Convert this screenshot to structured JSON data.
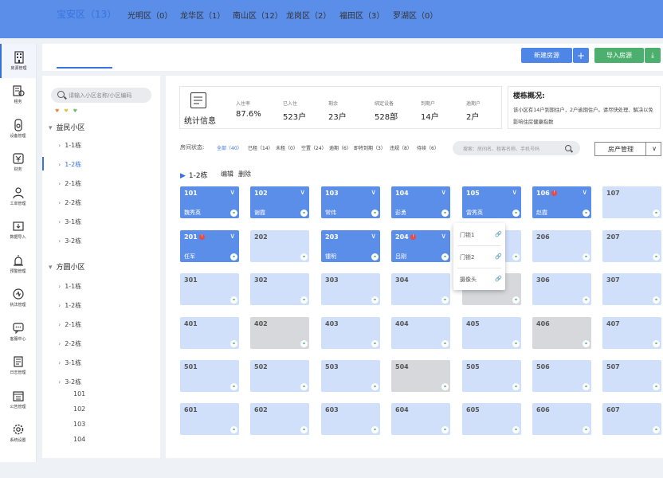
{
  "nav": [
    {
      "label": "房源管理",
      "icon": "building-icon",
      "active": true
    },
    {
      "label": "租务",
      "icon": "lease-icon"
    },
    {
      "label": "设备管理",
      "icon": "device-icon"
    },
    {
      "label": "财务",
      "icon": "finance-icon"
    },
    {
      "label": "工单管理",
      "icon": "worker-icon"
    },
    {
      "label": "数据导入",
      "icon": "import-icon"
    },
    {
      "label": "预警管理",
      "icon": "alarm-icon"
    },
    {
      "label": "执法管理",
      "icon": "law-icon"
    },
    {
      "label": "客服中心",
      "icon": "chat-icon"
    },
    {
      "label": "日志管理",
      "icon": "log-icon"
    },
    {
      "label": "公告管理",
      "icon": "notice-icon"
    },
    {
      "label": "系统设置",
      "icon": "gear-icon"
    }
  ],
  "districts": [
    "宝安区（13）",
    "光明区（0）",
    "龙华区（1）",
    "南山区（12）",
    "龙岗区（2）",
    "福田区（3）",
    "罗湖区（0）"
  ],
  "toolbar": {
    "new_label": "新建房源",
    "plus_label": "+",
    "import_label": "导入房源",
    "download_label": "⤓"
  },
  "tree": {
    "search_placeholder": "请输入小区名称/小区编码",
    "dots": "♥ ♥ ♥",
    "groups": [
      {
        "name": "益民小区",
        "items": [
          "1-1栋",
          "1-2栋",
          "2-1栋",
          "2-2栋",
          "3-1栋",
          "3-2栋"
        ]
      },
      {
        "name": "方圆小区",
        "items": [
          "1-1栋",
          "1-2栋",
          "2-1栋",
          "2-2栋",
          "3-1栋",
          "3-2栋"
        ],
        "subitems": [
          "101",
          "102",
          "103",
          "104"
        ]
      }
    ]
  },
  "stats": {
    "title": "统计信息",
    "items": [
      {
        "label": "入住率",
        "value": "87.6%"
      },
      {
        "label": "已入住",
        "value": "523户"
      },
      {
        "label": "剩余",
        "value": "23户"
      },
      {
        "label": "绑定设备",
        "value": "528部"
      },
      {
        "label": "到期户",
        "value": "14户"
      },
      {
        "label": "逾期户",
        "value": "2户"
      }
    ]
  },
  "overview": {
    "title": "楼栋概况:",
    "text": "该小区有14户到期住户，2户逾期住户。请尽快处理、解决以免影响住房健康指数"
  },
  "status": {
    "label": "房间状态:",
    "filters": [
      "全部（40）",
      "已租（14）",
      "未租（0）",
      "空置（24）",
      "逾期（6）",
      "即将到期（3）",
      "违规（8）",
      "待续（6）"
    ]
  },
  "room_search_placeholder": "搜索：房间名、租客名称、手机号码",
  "manage_label": "房产管理",
  "building": {
    "title": "1-2栋",
    "edit_label": "编辑",
    "delete_label": "删除"
  },
  "rooms": [
    [
      {
        "num": "101",
        "tenant": "魏秀英",
        "state": "occupied"
      },
      {
        "num": "102",
        "tenant": "谢霞",
        "state": "occupied"
      },
      {
        "num": "103",
        "tenant": "常伟",
        "state": "occupied"
      },
      {
        "num": "104",
        "tenant": "彭勇",
        "state": "occupied"
      },
      {
        "num": "105",
        "tenant": "雷秀英",
        "state": "occupied"
      },
      {
        "num": "106",
        "tenant": "赵霞",
        "state": "occupied",
        "warn": true
      },
      {
        "num": "107",
        "tenant": "",
        "state": "vacant"
      }
    ],
    [
      {
        "num": "201",
        "tenant": "任军",
        "state": "occupied",
        "warn": true
      },
      {
        "num": "202",
        "tenant": "",
        "state": "vacant"
      },
      {
        "num": "203",
        "tenant": "锺明",
        "state": "occupied"
      },
      {
        "num": "204",
        "tenant": "吕刚",
        "state": "occupied",
        "warn": true
      },
      {
        "num": "205",
        "tenant": "",
        "state": "vacant"
      },
      {
        "num": "206",
        "tenant": "",
        "state": "vacant"
      },
      {
        "num": "207",
        "tenant": "",
        "state": "vacant"
      }
    ],
    [
      {
        "num": "301",
        "tenant": "",
        "state": "vacant"
      },
      {
        "num": "302",
        "tenant": "",
        "state": "vacant"
      },
      {
        "num": "303",
        "tenant": "",
        "state": "vacant"
      },
      {
        "num": "304",
        "tenant": "",
        "state": "vacant"
      },
      {
        "num": "305",
        "tenant": "",
        "state": "grey"
      },
      {
        "num": "306",
        "tenant": "",
        "state": "vacant"
      },
      {
        "num": "307",
        "tenant": "",
        "state": "vacant"
      }
    ],
    [
      {
        "num": "401",
        "tenant": "",
        "state": "vacant"
      },
      {
        "num": "402",
        "tenant": "",
        "state": "grey"
      },
      {
        "num": "403",
        "tenant": "",
        "state": "vacant"
      },
      {
        "num": "404",
        "tenant": "",
        "state": "vacant"
      },
      {
        "num": "405",
        "tenant": "",
        "state": "vacant"
      },
      {
        "num": "406",
        "tenant": "",
        "state": "grey"
      },
      {
        "num": "407",
        "tenant": "",
        "state": "vacant"
      }
    ],
    [
      {
        "num": "501",
        "tenant": "",
        "state": "vacant"
      },
      {
        "num": "502",
        "tenant": "",
        "state": "vacant"
      },
      {
        "num": "503",
        "tenant": "",
        "state": "vacant"
      },
      {
        "num": "504",
        "tenant": "",
        "state": "grey"
      },
      {
        "num": "505",
        "tenant": "",
        "state": "vacant"
      },
      {
        "num": "506",
        "tenant": "",
        "state": "vacant"
      },
      {
        "num": "507",
        "tenant": "",
        "state": "vacant"
      }
    ],
    [
      {
        "num": "601",
        "tenant": "",
        "state": "vacant"
      },
      {
        "num": "602",
        "tenant": "",
        "state": "vacant"
      },
      {
        "num": "603",
        "tenant": "",
        "state": "vacant"
      },
      {
        "num": "604",
        "tenant": "",
        "state": "vacant"
      },
      {
        "num": "605",
        "tenant": "",
        "state": "vacant"
      },
      {
        "num": "606",
        "tenant": "",
        "state": "vacant"
      },
      {
        "num": "607",
        "tenant": "",
        "state": "vacant"
      }
    ]
  ],
  "popup": [
    {
      "label": "门锁1",
      "linked": true
    },
    {
      "label": "门锁2",
      "linked": false
    },
    {
      "label": "摄像头",
      "linked": true
    }
  ],
  "colors": {
    "primary": "#5b8ee8",
    "success": "#4caf6e",
    "vacant": "#d0e0fb",
    "grey": "#d6d8dc",
    "warn": "#e84a4a"
  }
}
